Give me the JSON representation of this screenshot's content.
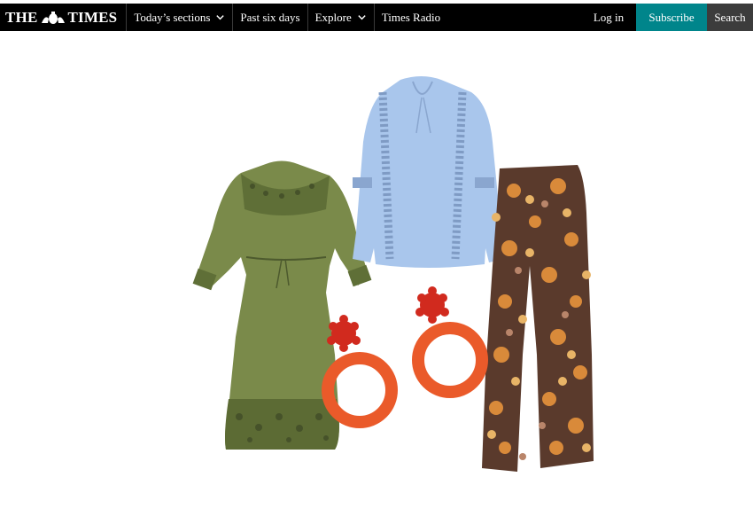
{
  "header": {
    "logo_left": "THE",
    "logo_right": "TIMES",
    "nav": [
      {
        "label": "Today’s sections",
        "has_dropdown": true
      },
      {
        "label": "Past six days",
        "has_dropdown": false
      },
      {
        "label": "Explore",
        "has_dropdown": true
      },
      {
        "label": "Times Radio",
        "has_dropdown": false
      }
    ],
    "login_label": "Log in",
    "subscribe_label": "Subscribe",
    "search_label": "Search"
  },
  "colors": {
    "nav_bg": "#000000",
    "subscribe_bg": "#00858b",
    "search_bg": "#3c3c3c"
  },
  "products": [
    {
      "name": "green-embroidered-dress"
    },
    {
      "name": "blue-lace-blouse"
    },
    {
      "name": "floral-flared-trousers"
    },
    {
      "name": "red-raffia-hoop-earrings"
    }
  ]
}
